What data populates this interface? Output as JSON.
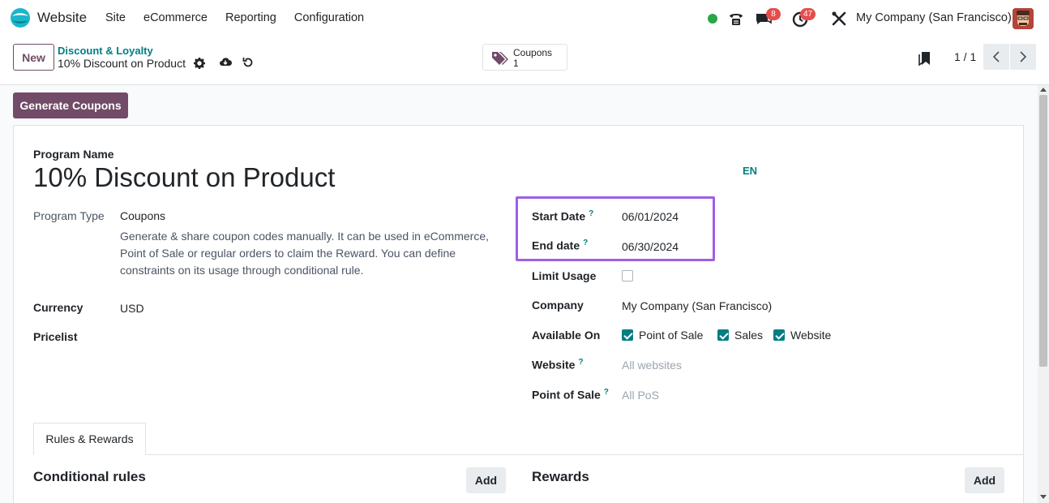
{
  "navbar": {
    "app_name": "Website",
    "menu": [
      "Site",
      "eCommerce",
      "Reporting",
      "Configuration"
    ],
    "messages_count": "8",
    "activities_count": "47",
    "company": "My Company (San Francisco)"
  },
  "control": {
    "new_label": "New",
    "breadcrumb_parent": "Discount & Loyalty",
    "breadcrumb_current": "10% Discount on Product",
    "smart_button": {
      "label": "Coupons",
      "value": "1"
    },
    "pager": "1 / 1"
  },
  "actions": {
    "generate_label": "Generate Coupons"
  },
  "form": {
    "program_name_label": "Program Name",
    "program_name": "10% Discount on Product",
    "lang": "EN",
    "program_type_label": "Program Type",
    "program_type": "Coupons",
    "program_type_desc": "Generate & share coupon codes manually. It can be used in eCommerce, Point of Sale or regular orders to claim the Reward. You can define constraints on its usage through conditional rule.",
    "currency_label": "Currency",
    "currency": "USD",
    "pricelist_label": "Pricelist",
    "start_date_label": "Start Date",
    "start_date": "06/01/2024",
    "end_date_label": "End date",
    "end_date": "06/30/2024",
    "limit_usage_label": "Limit Usage",
    "company_label": "Company",
    "company": "My Company (San Francisco)",
    "available_on_label": "Available On",
    "available_on": [
      {
        "label": "Point of Sale",
        "checked": true
      },
      {
        "label": "Sales",
        "checked": true
      },
      {
        "label": "Website",
        "checked": true
      }
    ],
    "website_label": "Website",
    "website_placeholder": "All websites",
    "pos_label": "Point of Sale",
    "pos_placeholder": "All PoS",
    "help_mark": "?"
  },
  "tabs": {
    "rules_rewards": "Rules & Rewards"
  },
  "sections": {
    "conditional_rules": "Conditional rules",
    "rewards": "Rewards",
    "add_label": "Add"
  },
  "colors": {
    "primary": "#714b67",
    "teal": "#017e84",
    "highlight": "#9f5fe6",
    "badge": "#e54d4d"
  }
}
